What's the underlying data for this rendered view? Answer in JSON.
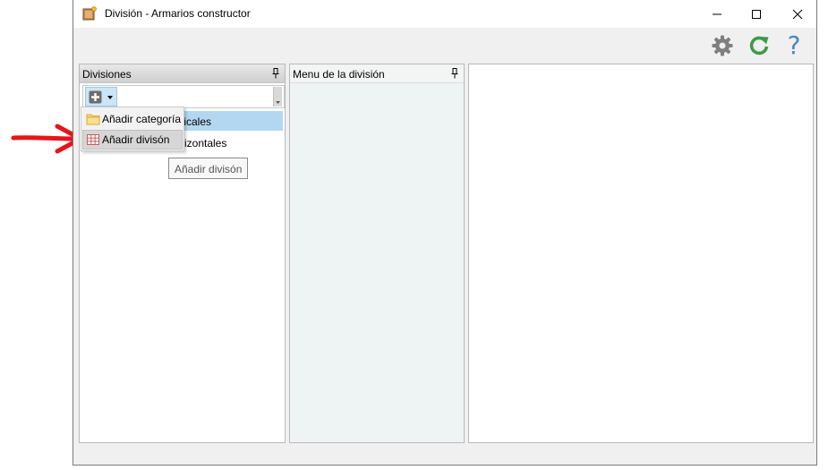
{
  "window": {
    "title": "División - Armarios constructor",
    "buttons": {
      "minimize": "minimize-icon",
      "maximize": "maximize-icon",
      "close": "close-icon"
    }
  },
  "toolbar": {
    "icons": [
      "gear-icon",
      "refresh-icon",
      "help-icon"
    ],
    "help_glyph": "?",
    "colors": {
      "gear": "#7f7f7f",
      "refresh": "#3e9a47",
      "help": "#4a86c8"
    }
  },
  "panels": {
    "divisions": {
      "title": "Divisiones",
      "rows": [
        {
          "label": "ticales",
          "selected": true
        },
        {
          "label": "rizontales",
          "selected": false
        }
      ]
    },
    "menu": {
      "title": "Menu de la división"
    }
  },
  "dropdown": {
    "items": [
      {
        "label": "Añadir categoría",
        "icon": "folder-icon"
      },
      {
        "label": "Añadir divisón",
        "icon": "table-icon"
      }
    ]
  },
  "tooltip": {
    "text": "Añadir divisón"
  },
  "annotation": {
    "icon": "red-arrow-icon",
    "color": "#e8141a"
  }
}
